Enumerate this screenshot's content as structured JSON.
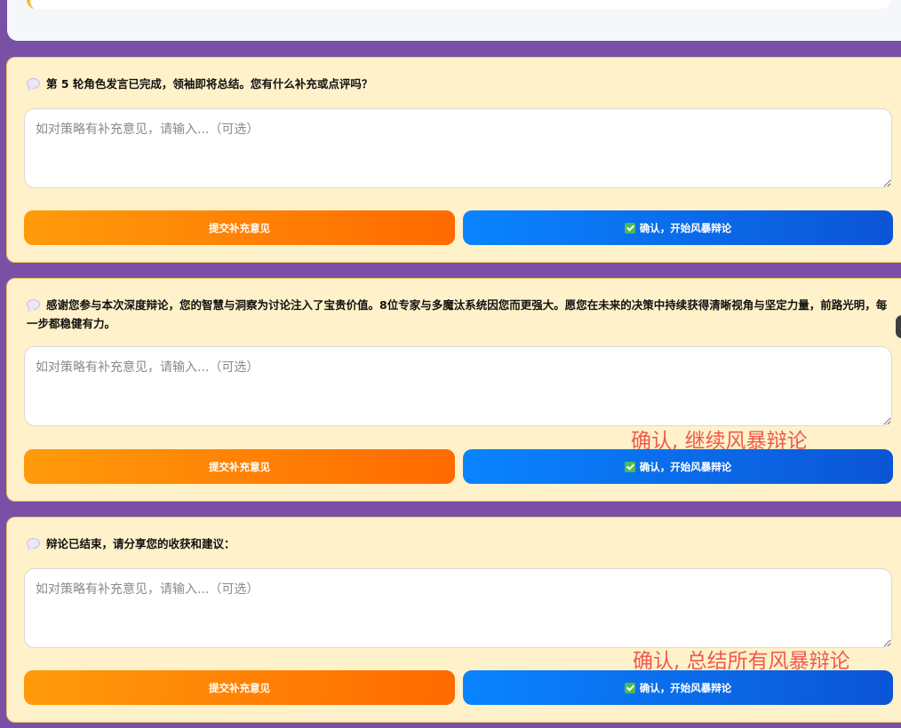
{
  "top_card": {},
  "panels": [
    {
      "prompt": "第 5 轮角色发言已完成，领袖即将总结。您有什么补充或点评吗？",
      "placeholder": "如对策略有补充意见，请输入...（可选）",
      "submit_label": "提交补充意见",
      "confirm_label": "确认，开始风暴辩论"
    },
    {
      "prompt": "感谢您参与本次深度辩论，您的智慧与洞察为讨论注入了宝贵价值。8位专家与多魔汰系统因您而更强大。愿您在未来的决策中持续获得清晰视角与坚定力量，前路光明，每一步都稳健有力。",
      "placeholder": "如对策略有补充意见，请输入...（可选）",
      "submit_label": "提交补充意见",
      "confirm_label": "确认，开始风暴辩论"
    },
    {
      "prompt": "辩论已结束，请分享您的收获和建议：",
      "placeholder": "如对策略有补充意见，请输入...（可选）",
      "submit_label": "提交补充意见",
      "confirm_label": "确认，开始风暴辩论"
    }
  ],
  "annotations": [
    "确认, 继续风暴辩论",
    "确认, 总结所有风暴辩论"
  ],
  "icons": {
    "prompt_icon": "speech-bubble-icon",
    "confirm_icon": "check-icon"
  },
  "colors": {
    "page_background": "#7a4fa6",
    "panel_background": "#fff1c9",
    "submit_button": "#ff7a00",
    "confirm_button": "#0a6ff0",
    "annotation": "#ee5a4e"
  }
}
